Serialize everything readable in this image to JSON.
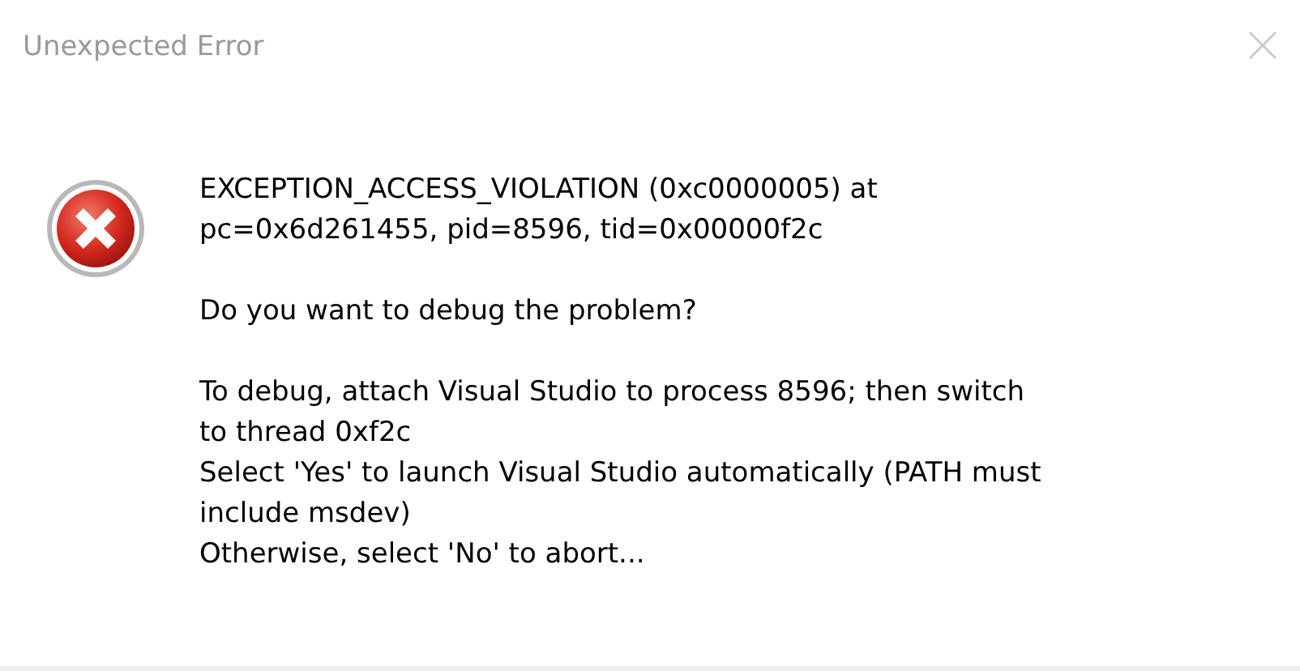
{
  "window": {
    "title": "Unexpected Error",
    "active": false
  },
  "message": {
    "paragraphs": [
      [
        "EXCEPTION_ACCESS_VIOLATION (0xc0000005) at",
        "pc=0x6d261455, pid=8596, tid=0x00000f2c"
      ],
      [
        "Do you want to debug the problem?"
      ],
      [
        "To debug, attach Visual Studio to process 8596; then switch",
        "to thread 0xf2c",
        "Select 'Yes' to launch Visual Studio automatically (PATH must",
        "include msdev)",
        "Otherwise, select 'No' to abort..."
      ]
    ]
  }
}
